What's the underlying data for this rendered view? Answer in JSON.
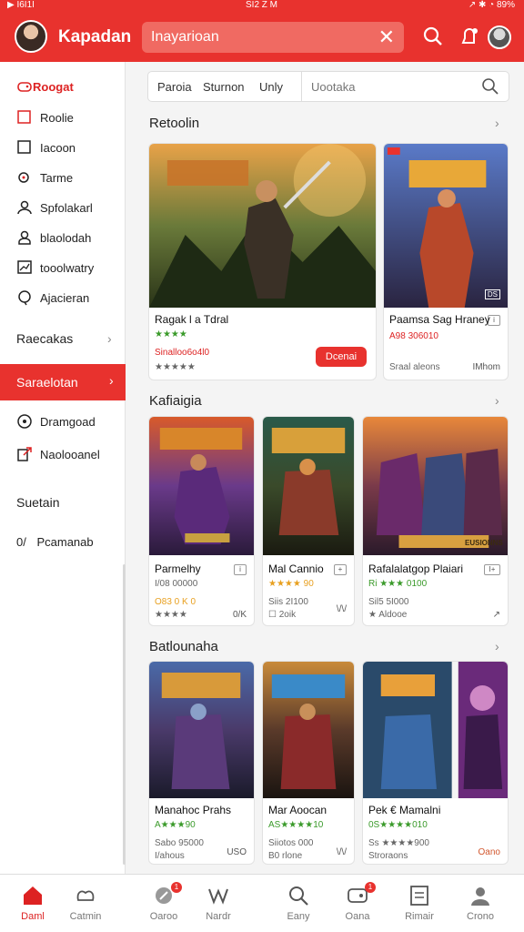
{
  "status_bar": {
    "left": "▶ I6I1I",
    "center": "SI2 Z M",
    "right": "↗ ✱ ◔ 89%"
  },
  "header": {
    "title": "Kapadan",
    "search_value": "Inayarioan",
    "search_placeholder": "Inayarioan"
  },
  "sidebar": {
    "top_item": "Roogat",
    "items": [
      "Roolie",
      "Iacoon",
      "Tarme",
      "Spfolakarl",
      "blaolodah",
      "tooolwatry",
      "Ajacieran"
    ],
    "section_1": "Raecakas",
    "selected": "Saraelotan",
    "items_2": [
      "Dramgoad",
      "Naolooanel"
    ],
    "section_2": "Suetain",
    "section_3_prefix": "0/",
    "section_3": "Pcamanab"
  },
  "filter": {
    "tabs": [
      "Paroia",
      "Sturnon",
      "Unly"
    ],
    "search_placeholder": "Uootaka"
  },
  "sections": [
    {
      "title": "Retoolin",
      "cards": [
        {
          "title": "Ragak l a Tdral",
          "stars": "★★★★",
          "price": "Sinalloo6o4l0",
          "rating": "★★★★★",
          "button": "Dcenai"
        },
        {
          "title": "Paamsa Sag Hraney",
          "price": "A98 306010",
          "meta": "Sraal aleons",
          "right": "IMhom",
          "badge": "i",
          "tag": "DS"
        }
      ]
    },
    {
      "title": "Kafiaigia",
      "cards": [
        {
          "title": "Parmelhy",
          "stars": "I/08 00000",
          "price": "O83 0 K 0",
          "rating": "★★★★",
          "right": "0/K",
          "badge": "i"
        },
        {
          "title": "Mal Cannio",
          "stars": "★★★★ 90",
          "meta": "Siis 2I100",
          "meta2": "☐ 2oik",
          "right": "\\/\\/",
          "badge": "+"
        },
        {
          "title": "Rafalalatgop Plaiari",
          "stars": "Ri ★★★ 0100",
          "meta": "Sil5 5I000",
          "meta2": "★ Aldooe",
          "right": "↗",
          "badge": "I+",
          "tag": "EUSIONNS"
        }
      ]
    },
    {
      "title": "Batlounaha",
      "cards": [
        {
          "title": "Manahoc Prahs",
          "stars": "A★★★90",
          "meta": "Sabo 95000",
          "meta2": "I/ahous",
          "right": "USO"
        },
        {
          "title": "Mar Aoocan",
          "stars": "AS★★★★10",
          "meta": "Siiotos 000",
          "meta2": "B0 rlone",
          "right": "\\/\\/"
        },
        {
          "title": "Pek € Mamalni",
          "stars": "0S★★★★010",
          "meta": "Ss ★★★★900",
          "meta2": "Stroraons",
          "right": "Oano"
        }
      ]
    }
  ],
  "bottom_nav": [
    {
      "label": "Daml",
      "icon": "home-icon",
      "active": true
    },
    {
      "label": "Catmin",
      "icon": "controller-icon"
    },
    {
      "label": "Oaroo",
      "icon": "rocket-icon",
      "badge": "1"
    },
    {
      "label": "Nardr",
      "icon": "mm-icon"
    },
    {
      "label": "Eany",
      "icon": "search-icon"
    },
    {
      "label": "Oana",
      "icon": "game-icon",
      "badge": "1"
    },
    {
      "label": "Rimair",
      "icon": "document-icon"
    },
    {
      "label": "Crono",
      "icon": "profile-icon"
    }
  ],
  "colors": {
    "accent": "#e8322e",
    "rating_green": "#3a9a2a"
  }
}
